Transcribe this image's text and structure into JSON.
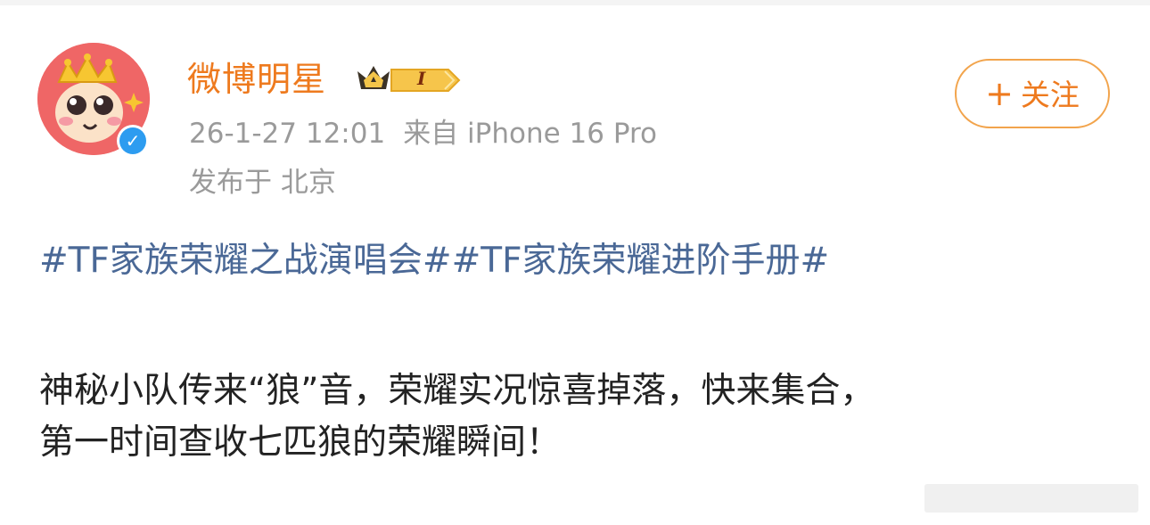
{
  "post": {
    "author": {
      "name": "微博明星",
      "vip_level": "I",
      "verified": true,
      "avatar": "cartoon-avatar-with-crown"
    },
    "time": "26-1-27 12:01",
    "source": "来自 iPhone 16 Pro",
    "location": "发布于 北京",
    "follow_label": "关注",
    "follow_icon": "plus-icon",
    "hashtags": [
      "#TF家族荣耀之战演唱会#",
      "#TF家族荣耀进阶手册#"
    ],
    "body_lines": [
      "神秘小队传来“狼”音，荣耀实况惊喜掉落，快来集合，",
      "第一时间查收七匹狼的荣耀瞬间！"
    ]
  },
  "colors": {
    "accent": "#ee7a1e",
    "hashtag": "#4a6896",
    "meta": "#9a9a9a",
    "text": "#222222",
    "avatar_bg": "#ef6666",
    "verified": "#2d9cf0"
  }
}
